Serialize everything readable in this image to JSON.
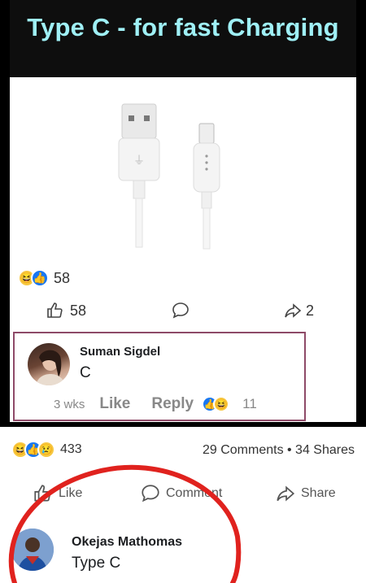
{
  "banner": {
    "title": "Type C - for fast Charging"
  },
  "inner_post": {
    "reaction_count": "58",
    "like_count": "58",
    "share_count": "2"
  },
  "inner_comment": {
    "author": "Suman Sigdel",
    "text": "C",
    "time": "3 wks",
    "like_label": "Like",
    "reply_label": "Reply",
    "reaction_count": "11"
  },
  "outer_post": {
    "reaction_count": "433",
    "stats": "29 Comments • 34 Shares",
    "actions": {
      "like": "Like",
      "comment": "Comment",
      "share": "Share"
    }
  },
  "comment2": {
    "author": "Okejas Mathomas",
    "text": "Type C"
  },
  "colors": {
    "brand_blue": "#1877f2",
    "annotation_red": "#e0221e",
    "banner_text": "#9ff0f6"
  },
  "icons": [
    "haha-reaction-icon",
    "like-reaction-icon",
    "sad-reaction-icon",
    "thumbs-up-icon",
    "comment-bubble-icon",
    "share-arrow-icon"
  ]
}
